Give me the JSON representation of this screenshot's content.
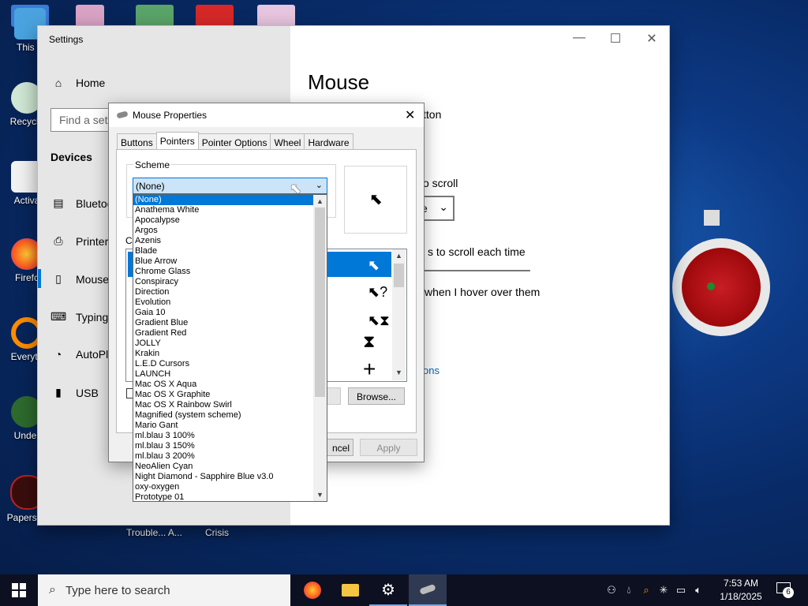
{
  "desktop": {
    "icons": [
      {
        "label": "This P"
      },
      {
        "label": "Recycle"
      },
      {
        "label": "Activa"
      },
      {
        "label": "Firefc"
      },
      {
        "label": "Everyth"
      },
      {
        "label": "Under"
      },
      {
        "label": "Papers, P"
      }
    ],
    "bottom_labels": [
      "Trouble... A...",
      "Crisis"
    ]
  },
  "settings": {
    "title": "Settings",
    "controls": {
      "minimize": "—",
      "maximize": "☐",
      "close": "✕"
    },
    "sidebar": {
      "home": "Home",
      "search_placeholder": "Find a setting",
      "section": "Devices",
      "items": [
        {
          "label": "Bluetooth & other devices"
        },
        {
          "label": "Printers & scanners"
        },
        {
          "label": "Mouse"
        },
        {
          "label": "Typing"
        },
        {
          "label": "AutoPlay"
        },
        {
          "label": "USB"
        }
      ]
    },
    "main": {
      "heading": "Mouse",
      "line1": "tton",
      "line2": "o scroll",
      "dropdown_value": "e",
      "line3": "s to scroll each time",
      "line4": "when I hover over them",
      "link": "ons"
    }
  },
  "mouse_properties": {
    "title": "Mouse Properties",
    "close": "✕",
    "tabs": [
      {
        "label": "Buttons",
        "active": false
      },
      {
        "label": "Pointers",
        "active": true
      },
      {
        "label": "Pointer Options",
        "active": false
      },
      {
        "label": "Wheel",
        "active": false
      },
      {
        "label": "Hardware",
        "active": false
      }
    ],
    "scheme_label": "Scheme",
    "scheme_value": "(None)",
    "customize_label": "Cu",
    "browse_button": "Browse...",
    "cancel_button": "ncel",
    "apply_button": "Apply",
    "scheme_options": [
      "(None)",
      "Anathema White",
      "Apocalypse",
      "Argos",
      "Azenis",
      "Blade",
      "Blue Arrow",
      "Chrome Glass",
      "Conspiracy",
      "Direction",
      "Evolution",
      "Gaia 10",
      "Gradient Blue",
      "Gradient Red",
      "JOLLY",
      "Krakin",
      "L.E.D Cursors",
      "LAUNCH",
      "Mac OS X Aqua",
      "Mac OS X Graphite",
      "Mac OS X Rainbow Swirl",
      "Magnified (system scheme)",
      "Mario Gant",
      "ml.blau 3 100%",
      "ml.blau 3 150%",
      "ml.blau 3 200%",
      "NeoAlien Cyan",
      "Night Diamond - Sapphire Blue v3.0",
      "oxy-oxygen",
      "Prototype 01"
    ],
    "selected_index": 0
  },
  "taskbar": {
    "search_placeholder": "Type here to search",
    "time": "7:53 AM",
    "date": "1/18/2025",
    "notification_count": "6"
  },
  "colors": {
    "accent": "#0078d7",
    "taskbar": "#0c1020",
    "settings_side": "#e6e6e6"
  }
}
